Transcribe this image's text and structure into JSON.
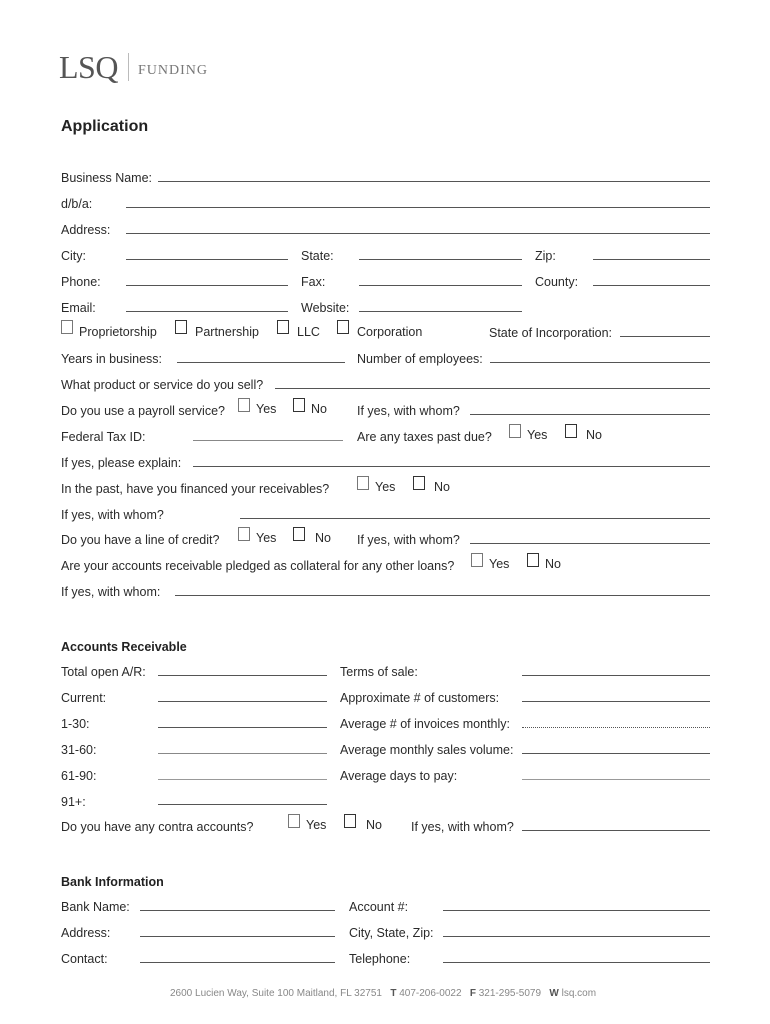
{
  "logo": {
    "brand": "LSQ",
    "sub": "FUNDING"
  },
  "title": "Application",
  "business": {
    "business_name": "Business Name:",
    "dba": "d/b/a:",
    "address": "Address:",
    "city": "City:",
    "state": "State:",
    "zip": "Zip:",
    "phone": "Phone:",
    "fax": "Fax:",
    "county": "County:",
    "email": "Email:",
    "website": "Website:",
    "entity_types": [
      "Proprietorship",
      "Partnership",
      "LLC",
      "Corporation"
    ],
    "state_of_incorporation": "State of Incorporation:",
    "years_in_business": "Years in business:",
    "num_employees": "Number of employees:",
    "product_service": "What product or service do you sell?",
    "payroll_q": "Do you use a payroll service?",
    "if_yes_whom_q": "If yes, with whom?",
    "federal_tax_id": "Federal Tax ID:",
    "taxes_past_due": "Are any taxes past due?",
    "please_explain": "If yes, please explain:",
    "financed_receivables": "In the past, have you financed your receivables?",
    "if_yes_whom": "If yes, with whom?",
    "line_of_credit": "Do you have a line of credit?",
    "pledged_collateral": "Are your accounts receivable pledged as collateral for any other loans?",
    "if_yes_whom_colon": "If yes, with whom:",
    "yes": "Yes",
    "no": "No"
  },
  "accounts_receivable": {
    "heading": "Accounts Receivable",
    "left": [
      "Total open A/R:",
      "Current:",
      "1-30:",
      "31-60:",
      "61-90:",
      "91+:"
    ],
    "right": [
      "Terms of sale:",
      "Approximate # of customers:",
      "Average # of invoices monthly:",
      "Average monthly sales volume:",
      "Average days to pay:"
    ],
    "contra_q": "Do you have any contra accounts?",
    "if_yes_whom": "If yes, with whom?"
  },
  "bank": {
    "heading": "Bank Information",
    "bank_name": "Bank Name:",
    "account": "Account #:",
    "address": "Address:",
    "city_state_zip": "City, State, Zip:",
    "contact": "Contact:",
    "telephone": "Telephone:"
  },
  "footer": {
    "address": "2600 Lucien Way, Suite 100   Maitland, FL 32751",
    "t_label": "T",
    "phone": "407-206-0022",
    "f_label": "F",
    "fax": "321-295-5079",
    "w_label": "W",
    "web": "lsq.com"
  }
}
